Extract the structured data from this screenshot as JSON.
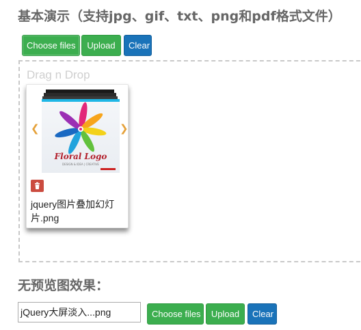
{
  "basic_demo": {
    "title": "基本演示（支持jpg、gif、txt、png和pdf格式文件）",
    "buttons": {
      "choose": "Choose files",
      "upload": "Upload",
      "clear": "Clear"
    },
    "drop_zone": {
      "label": "Drag n Drop",
      "file": {
        "name": "jquery图片叠加幻灯片.png",
        "thumbnail": "floral-logo-thumbnail",
        "thumbnail_text": "Floral Logo",
        "thumbnail_subtext": "DESIGN & IDEA | CREATIVE",
        "prev_icon": "chevron-left-icon",
        "next_icon": "chevron-right-icon",
        "delete_icon": "trash-icon"
      }
    }
  },
  "no_preview": {
    "title": "无预览图效果：",
    "input_value": "jQuery大屏淡入...png",
    "buttons": {
      "choose": "Choose files",
      "upload": "Upload",
      "clear": "Clear"
    }
  },
  "colors": {
    "green_button": "#3cae4f",
    "blue_button": "#1a73b9",
    "delete_button": "#cb4b3f",
    "arrow": "#e5a23b",
    "title": "#666666"
  }
}
